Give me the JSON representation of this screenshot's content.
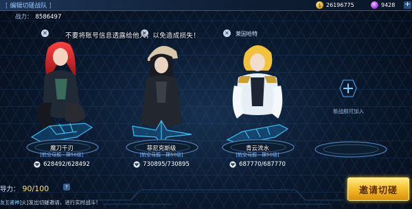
{
  "header": {
    "title": "编辑切磋战队",
    "power_label": "战力：",
    "power_value": "8586497",
    "gold": "26196775",
    "gems": "9428",
    "plus": "+"
  },
  "toast": {
    "message": "不要将账号信息透露给他人，以免造成损失！"
  },
  "slots": [
    {
      "slot_label": "",
      "name": "魔刀千刃",
      "type": "[航空母舰 - 肆50级]",
      "hp": "628492/628492"
    },
    {
      "slot_label": "",
      "name": "菲尼克斯级",
      "type": "[航空母舰 - 肆50级]",
      "hp": "730895/730895"
    },
    {
      "slot_label": "莱因哈特",
      "name": "青云流水",
      "type": "[航空母舰 - 肆50级]",
      "hp": "687770/687770"
    }
  ],
  "empty_slot": {
    "label": "新战舰可加入"
  },
  "leadership": {
    "label": "导力：",
    "value": "90/100",
    "help": "?"
  },
  "chat": {
    "channel": "友]",
    "sender": "[诸神]",
    "text": "火]发出切磋邀请，进行实时战斗！"
  },
  "invite_button": "邀请切磋",
  "colors": {
    "accent": "#5fa3ff",
    "hologram": "#3fc8ff",
    "button_gold": "#f6c22e"
  }
}
